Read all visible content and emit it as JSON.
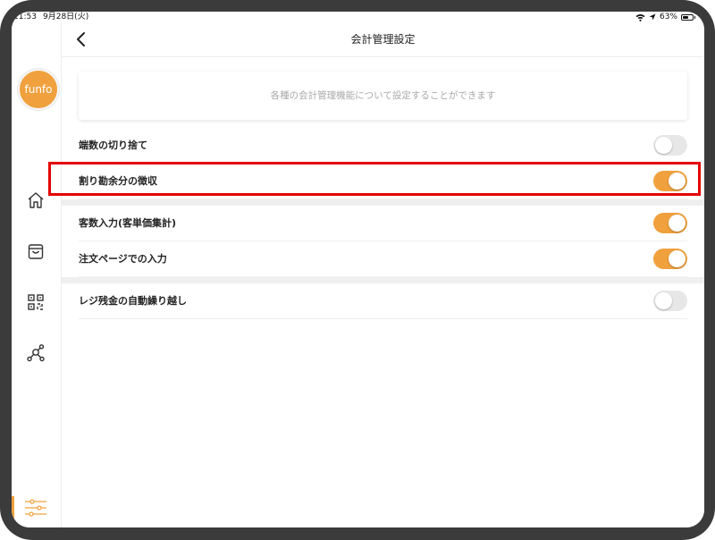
{
  "status_bar": {
    "time": "11:53",
    "date": "9月28日(火)",
    "battery": "63%",
    "battery_level": 0.63
  },
  "sidebar": {
    "logo_text": "funfo",
    "items": [
      {
        "icon": "home-icon"
      },
      {
        "icon": "shopping-bag-icon"
      },
      {
        "icon": "qr-code-icon"
      },
      {
        "icon": "network-icon"
      },
      {
        "icon": "settings-sliders-icon",
        "active": true
      }
    ]
  },
  "header": {
    "title": "会計管理設定"
  },
  "info_card": {
    "text": "各種の会計管理機能について設定することができます"
  },
  "settings": [
    {
      "label": "端数の切り捨て",
      "on": false
    },
    {
      "label": "割り勘余分の徴収",
      "on": true,
      "highlighted": true
    },
    {
      "label": "客数入力(客単価集計)",
      "on": true
    },
    {
      "label": "注文ページでの入力",
      "on": true
    },
    {
      "label": "レジ残金の自動繰り越し",
      "on": false
    }
  ],
  "colors": {
    "accent": "#f0a13e",
    "highlight": "#e40000"
  }
}
